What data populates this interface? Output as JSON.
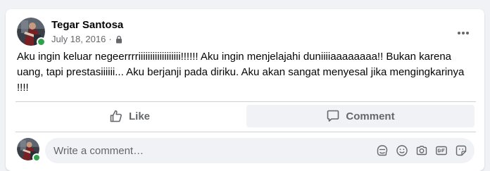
{
  "post": {
    "author": "Tegar Santosa",
    "date": "July 18, 2016",
    "separator": "·",
    "privacy_icon": "lock-icon",
    "text": "Aku ingin keluar negeerrrriiiiiiiiiiiiiiiiii!!!!!! Aku ingin menjelajahi duniiiiaaaaaaaa!! Bukan karena uang, tapi prestasiiiiii... Aku berjanji pada diriku. Aku akan sangat menyesal jika mengingkarinya !!!!"
  },
  "actions": {
    "like_label": "Like",
    "comment_label": "Comment"
  },
  "comment": {
    "placeholder": "Write a comment…",
    "icons": [
      "avatar-sticker-icon",
      "emoji-icon",
      "camera-icon",
      "gif-icon",
      "sticker-icon"
    ]
  },
  "colors": {
    "online": "#31a24c",
    "text_primary": "#050505",
    "text_secondary": "#65676b",
    "background": "#f0f2f5"
  }
}
